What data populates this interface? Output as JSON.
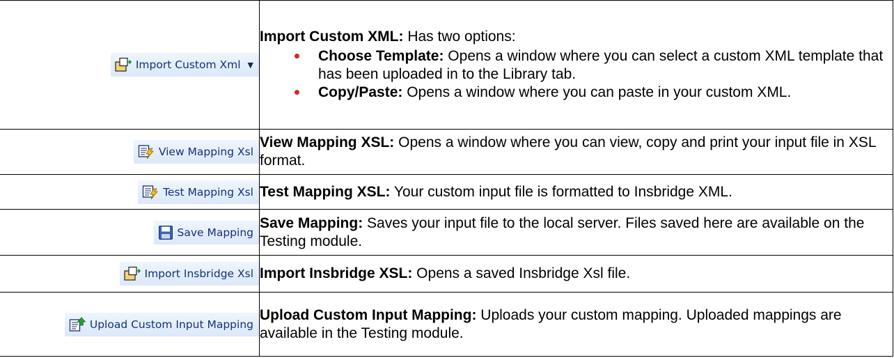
{
  "colors": {
    "bullet": "#e2231a",
    "button_text": "#15317a",
    "button_bg": "#e4eefa"
  },
  "rows": [
    {
      "button": {
        "label": "Import Custom Xml",
        "icon": "import-folder-icon",
        "has_dropdown": true
      },
      "term": "Import Custom XML:",
      "text": " Has two options:",
      "options": [
        {
          "term": "Choose Template:",
          "text": " Opens a window where you can select a custom XML template that has been uploaded in to the Library tab."
        },
        {
          "term": "Copy/Paste:",
          "text": " Opens a window where you can paste in your custom XML."
        }
      ]
    },
    {
      "button": {
        "label": "View Mapping Xsl",
        "icon": "mapping-lightning-icon"
      },
      "term": "View Mapping XSL:",
      "text": " Opens a window where you can view, copy and print your input file in XSL format."
    },
    {
      "button": {
        "label": "Test Mapping Xsl",
        "icon": "mapping-lightning-icon"
      },
      "term": "Test Mapping XSL:",
      "text": " Your custom input file is formatted to Insbridge XML."
    },
    {
      "button": {
        "label": "Save Mapping",
        "icon": "floppy-disk-icon"
      },
      "term": "Save Mapping:",
      "text": " Saves your input file to the local server. Files saved here are available on the Testing module."
    },
    {
      "button": {
        "label": "Import Insbridge Xsl",
        "icon": "import-folder-icon"
      },
      "term": "Import Insbridge XSL:",
      "text": " Opens a saved Insbridge Xsl file."
    },
    {
      "button": {
        "label": "Upload Custom Input Mapping",
        "icon": "upload-document-icon"
      },
      "term": "Upload Custom Input Mapping:",
      "text": " Uploads your custom mapping. Uploaded mappings are available in the Testing module."
    }
  ]
}
